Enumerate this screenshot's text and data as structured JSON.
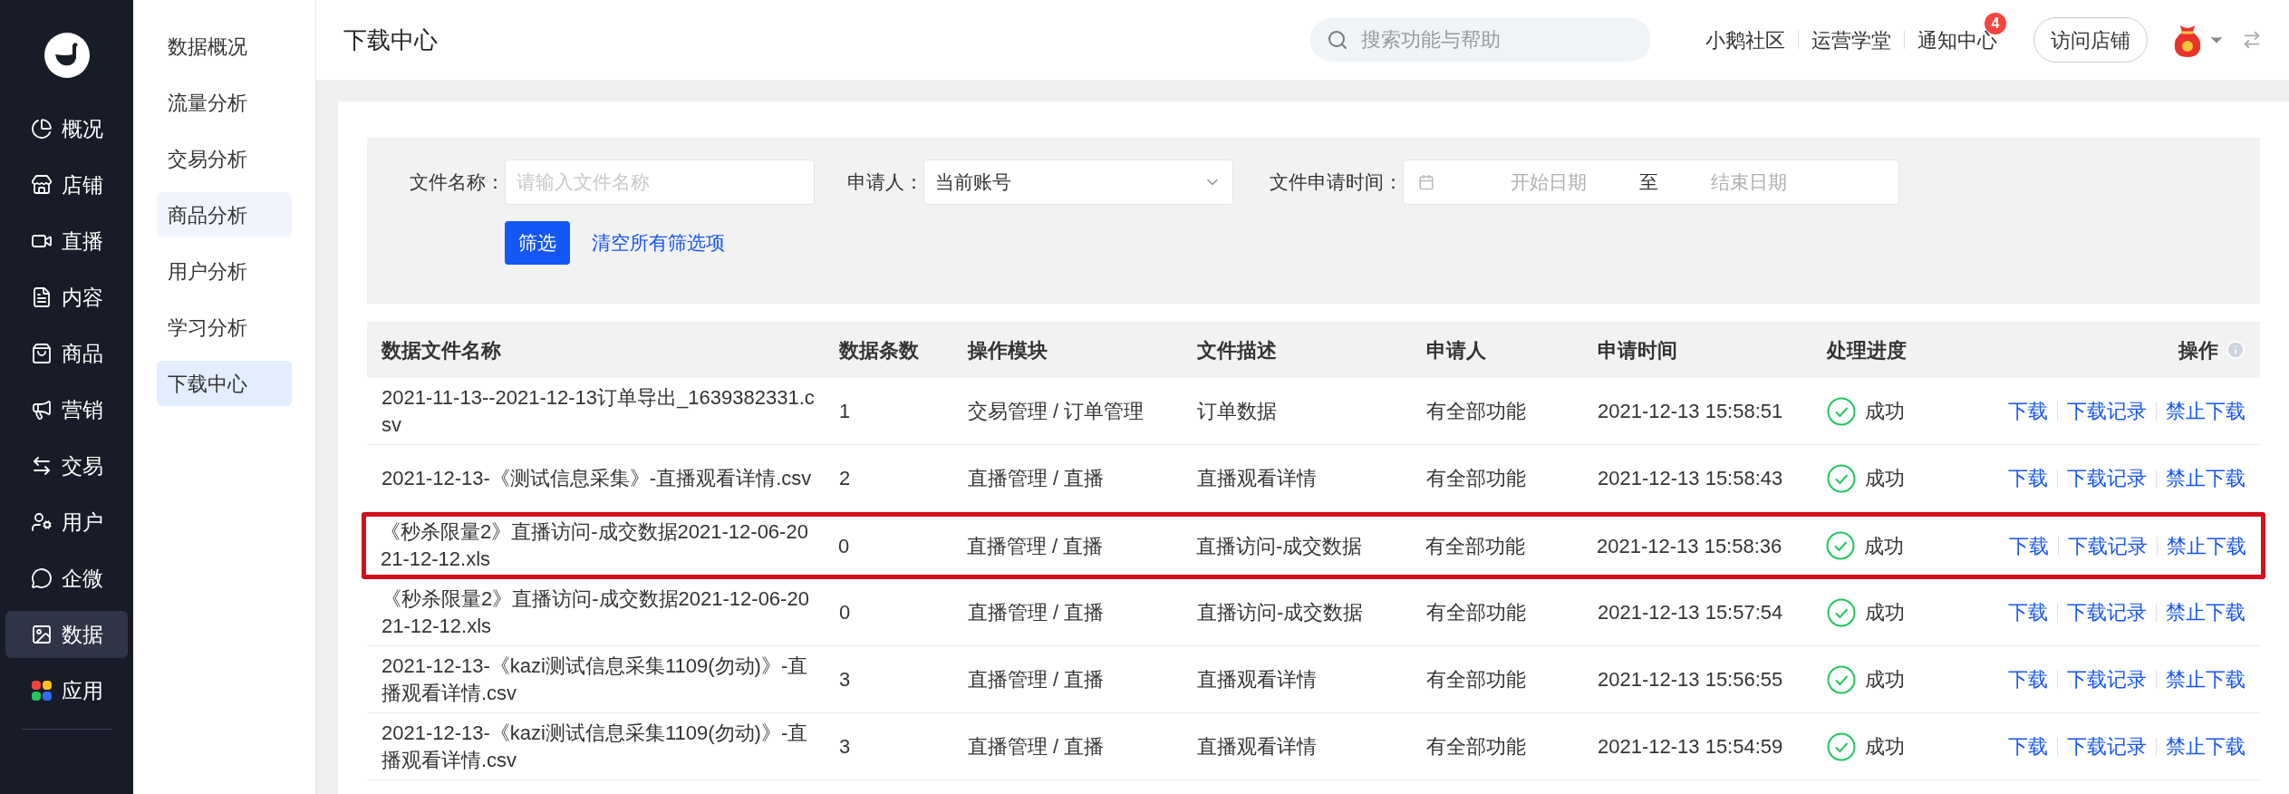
{
  "main_nav": [
    {
      "label": "概况",
      "selected": false
    },
    {
      "label": "店铺",
      "selected": false
    },
    {
      "label": "直播",
      "selected": false
    },
    {
      "label": "内容",
      "selected": false
    },
    {
      "label": "商品",
      "selected": false
    },
    {
      "label": "营销",
      "selected": false
    },
    {
      "label": "交易",
      "selected": false
    },
    {
      "label": "用户",
      "selected": false
    },
    {
      "label": "企微",
      "selected": false
    },
    {
      "label": "数据",
      "selected": true
    },
    {
      "label": "应用",
      "selected": false
    }
  ],
  "sub_nav": [
    {
      "label": "数据概况",
      "selected": false,
      "hovered": false
    },
    {
      "label": "流量分析",
      "selected": false,
      "hovered": false
    },
    {
      "label": "交易分析",
      "selected": false,
      "hovered": false
    },
    {
      "label": "商品分析",
      "selected": false,
      "hovered": true
    },
    {
      "label": "用户分析",
      "selected": false,
      "hovered": false
    },
    {
      "label": "学习分析",
      "selected": false,
      "hovered": false
    },
    {
      "label": "下载中心",
      "selected": true,
      "hovered": false
    }
  ],
  "page_title": "下载中心",
  "search": {
    "placeholder": "搜索功能与帮助"
  },
  "top_links": [
    {
      "label": "小鹅社区"
    },
    {
      "label": "运营学堂"
    },
    {
      "label": "通知中心",
      "badge": "4"
    }
  ],
  "visit_button": "访问店铺",
  "filters": {
    "file_name": {
      "label": "文件名称：",
      "placeholder": "请输入文件名称"
    },
    "applicant": {
      "label": "申请人：",
      "value": "当前账号"
    },
    "time": {
      "label": "文件申请时间：",
      "start_placeholder": "开始日期",
      "separator": "至",
      "end_placeholder": "结束日期"
    },
    "filter_button": "筛选",
    "clear_link": "清空所有筛选项"
  },
  "table": {
    "columns": [
      "数据文件名称",
      "数据条数",
      "操作模块",
      "文件描述",
      "申请人",
      "申请时间",
      "处理进度",
      "操作"
    ],
    "rows": [
      {
        "cells": [
          "2021-11-13--2021-12-13订单导出_1639382331.csv",
          "1",
          "交易管理 / 订单管理",
          "订单数据",
          "有全部功能",
          "2021-12-13 15:58:51"
        ],
        "status": "成功",
        "success": true,
        "actions": [
          "下载",
          "下载记录",
          "禁止下载"
        ],
        "highlighted": false
      },
      {
        "cells": [
          "2021-12-13-《测试信息采集》-直播观看详情.csv",
          "2",
          "直播管理 / 直播",
          "直播观看详情",
          "有全部功能",
          "2021-12-13 15:58:43"
        ],
        "status": "成功",
        "success": true,
        "actions": [
          "下载",
          "下载记录",
          "禁止下载"
        ],
        "highlighted": false
      },
      {
        "cells": [
          "《秒杀限量2》直播访问-成交数据2021-12-06-2021-12-12.xls",
          "0",
          "直播管理 / 直播",
          "直播访问-成交数据",
          "有全部功能",
          "2021-12-13 15:58:36"
        ],
        "status": "成功",
        "success": true,
        "actions": [
          "下载",
          "下载记录",
          "禁止下载"
        ],
        "highlighted": true
      },
      {
        "cells": [
          "《秒杀限量2》直播访问-成交数据2021-12-06-2021-12-12.xls",
          "0",
          "直播管理 / 直播",
          "直播访问-成交数据",
          "有全部功能",
          "2021-12-13 15:57:54"
        ],
        "status": "成功",
        "success": true,
        "actions": [
          "下载",
          "下载记录",
          "禁止下载"
        ],
        "highlighted": false
      },
      {
        "cells": [
          "2021-12-13-《kazi测试信息采集1109(勿动)》-直播观看详情.csv",
          "3",
          "直播管理 / 直播",
          "直播观看详情",
          "有全部功能",
          "2021-12-13 15:56:55"
        ],
        "status": "成功",
        "success": true,
        "actions": [
          "下载",
          "下载记录",
          "禁止下载"
        ],
        "highlighted": false
      },
      {
        "cells": [
          "2021-12-13-《kazi测试信息采集1109(勿动)》-直播观看详情.csv",
          "3",
          "直播管理 / 直播",
          "直播观看详情",
          "有全部功能",
          "2021-12-13 15:54:59"
        ],
        "status": "成功",
        "success": true,
        "actions": [
          "下载",
          "下载记录",
          "禁止下载"
        ],
        "highlighted": false
      }
    ]
  }
}
